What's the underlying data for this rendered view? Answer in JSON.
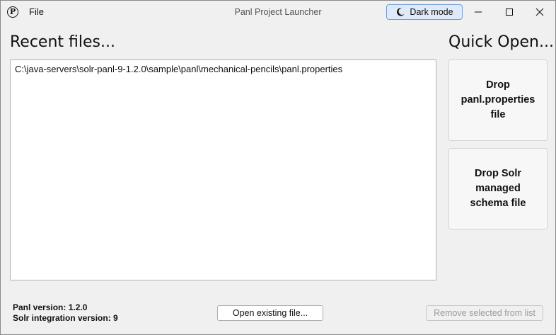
{
  "window": {
    "title": "Panl Project Launcher",
    "icon_glyph": "P",
    "menu": {
      "file": "File"
    },
    "dark_mode_label": "Dark mode"
  },
  "recent": {
    "heading": "Recent files...",
    "items": [
      {
        "path": "C:\\java-servers\\solr-panl-9-1.2.0\\sample\\panl\\mechanical-pencils\\panl.properties"
      }
    ]
  },
  "quick_open": {
    "heading": "Quick Open...",
    "drop_properties": "Drop panl.properties file",
    "drop_schema": "Drop Solr managed schema file"
  },
  "footer": {
    "panl_version": "Panl version: 1.2.0",
    "solr_version": "Solr integration version: 9",
    "open_button": "Open existing file...",
    "remove_button": "Remove selected from list"
  },
  "colors": {
    "accent_border": "#6f9fd8",
    "accent_fill": "#dfe9f7",
    "disabled_text": "#9a9a9a"
  }
}
